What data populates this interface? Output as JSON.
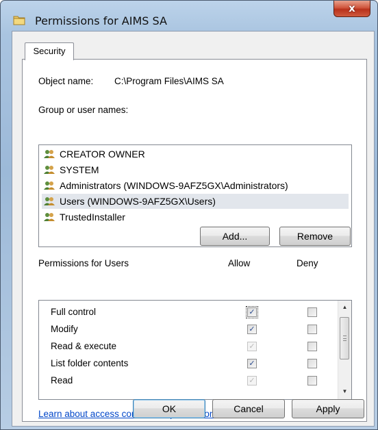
{
  "window": {
    "title": "Permissions for AIMS SA",
    "close_glyph": "x"
  },
  "tabs": [
    {
      "label": "Security",
      "active": true
    }
  ],
  "object": {
    "label": "Object name:",
    "value": "C:\\Program Files\\AIMS SA"
  },
  "group_list": {
    "label": "Group or user names:",
    "items": [
      {
        "name": "CREATOR OWNER",
        "selected": false
      },
      {
        "name": "SYSTEM",
        "selected": false
      },
      {
        "name": "Administrators (WINDOWS-9AFZ5GX\\Administrators)",
        "selected": false
      },
      {
        "name": "Users (WINDOWS-9AFZ5GX\\Users)",
        "selected": true
      },
      {
        "name": "TrustedInstaller",
        "selected": false
      }
    ]
  },
  "buttons": {
    "add": "Add...",
    "remove": "Remove",
    "ok": "OK",
    "cancel": "Cancel",
    "apply": "Apply"
  },
  "permissions": {
    "header": "Permissions for Users",
    "allow_label": "Allow",
    "deny_label": "Deny",
    "rows": [
      {
        "name": "Full control",
        "allow": true,
        "allow_dim": false,
        "deny": false
      },
      {
        "name": "Modify",
        "allow": true,
        "allow_dim": false,
        "deny": false
      },
      {
        "name": "Read & execute",
        "allow": true,
        "allow_dim": true,
        "deny": false
      },
      {
        "name": "List folder contents",
        "allow": true,
        "allow_dim": false,
        "deny": false
      },
      {
        "name": "Read",
        "allow": true,
        "allow_dim": true,
        "deny": false
      }
    ]
  },
  "link": {
    "text": "Learn about access control and permissions"
  },
  "colors": {
    "link": "#0046c9",
    "selection": "#e2e6ec",
    "close_button": "#c8462c"
  }
}
